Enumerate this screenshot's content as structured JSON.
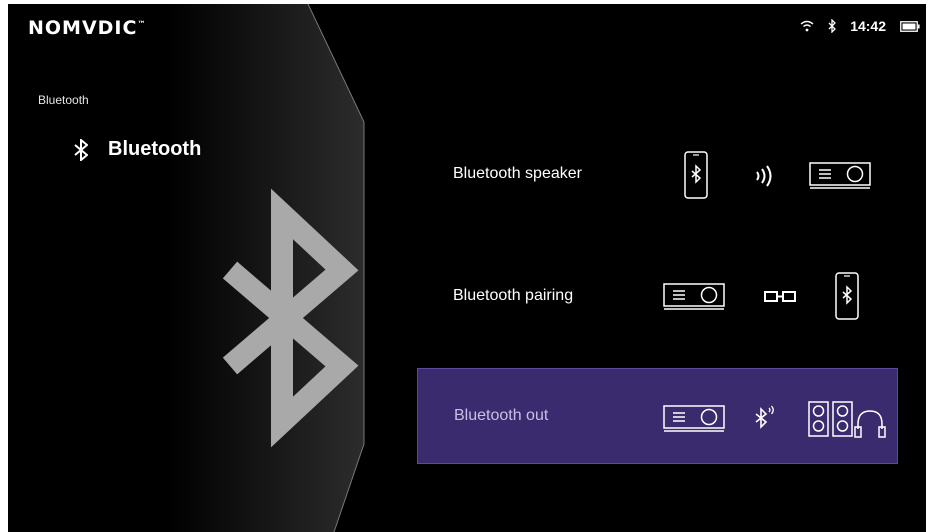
{
  "brand": {
    "name": "NOMVDIC",
    "mark": "™"
  },
  "status": {
    "time": "14:42",
    "icons": [
      "wifi-icon",
      "bluetooth-icon",
      "battery-icon"
    ]
  },
  "breadcrumb": "Bluetooth",
  "category": {
    "label": "Bluetooth",
    "icon": "bluetooth-icon"
  },
  "menu": {
    "items": [
      {
        "label": "Bluetooth speaker",
        "icons": [
          "phone-bluetooth-icon",
          "sound-waves-icon",
          "projector-icon"
        ]
      },
      {
        "label": "Bluetooth pairing",
        "icons": [
          "projector-icon",
          "link-icon",
          "phone-bluetooth-icon"
        ]
      },
      {
        "label": "Bluetooth out",
        "icons": [
          "projector-icon",
          "bluetooth-signal-icon",
          "speakers-icon",
          "headphones-icon"
        ]
      }
    ],
    "selected_index": 2
  },
  "colors": {
    "selected_bg": "#3a2b6e",
    "background": "#000000",
    "watermark": "#a9a9a9"
  }
}
